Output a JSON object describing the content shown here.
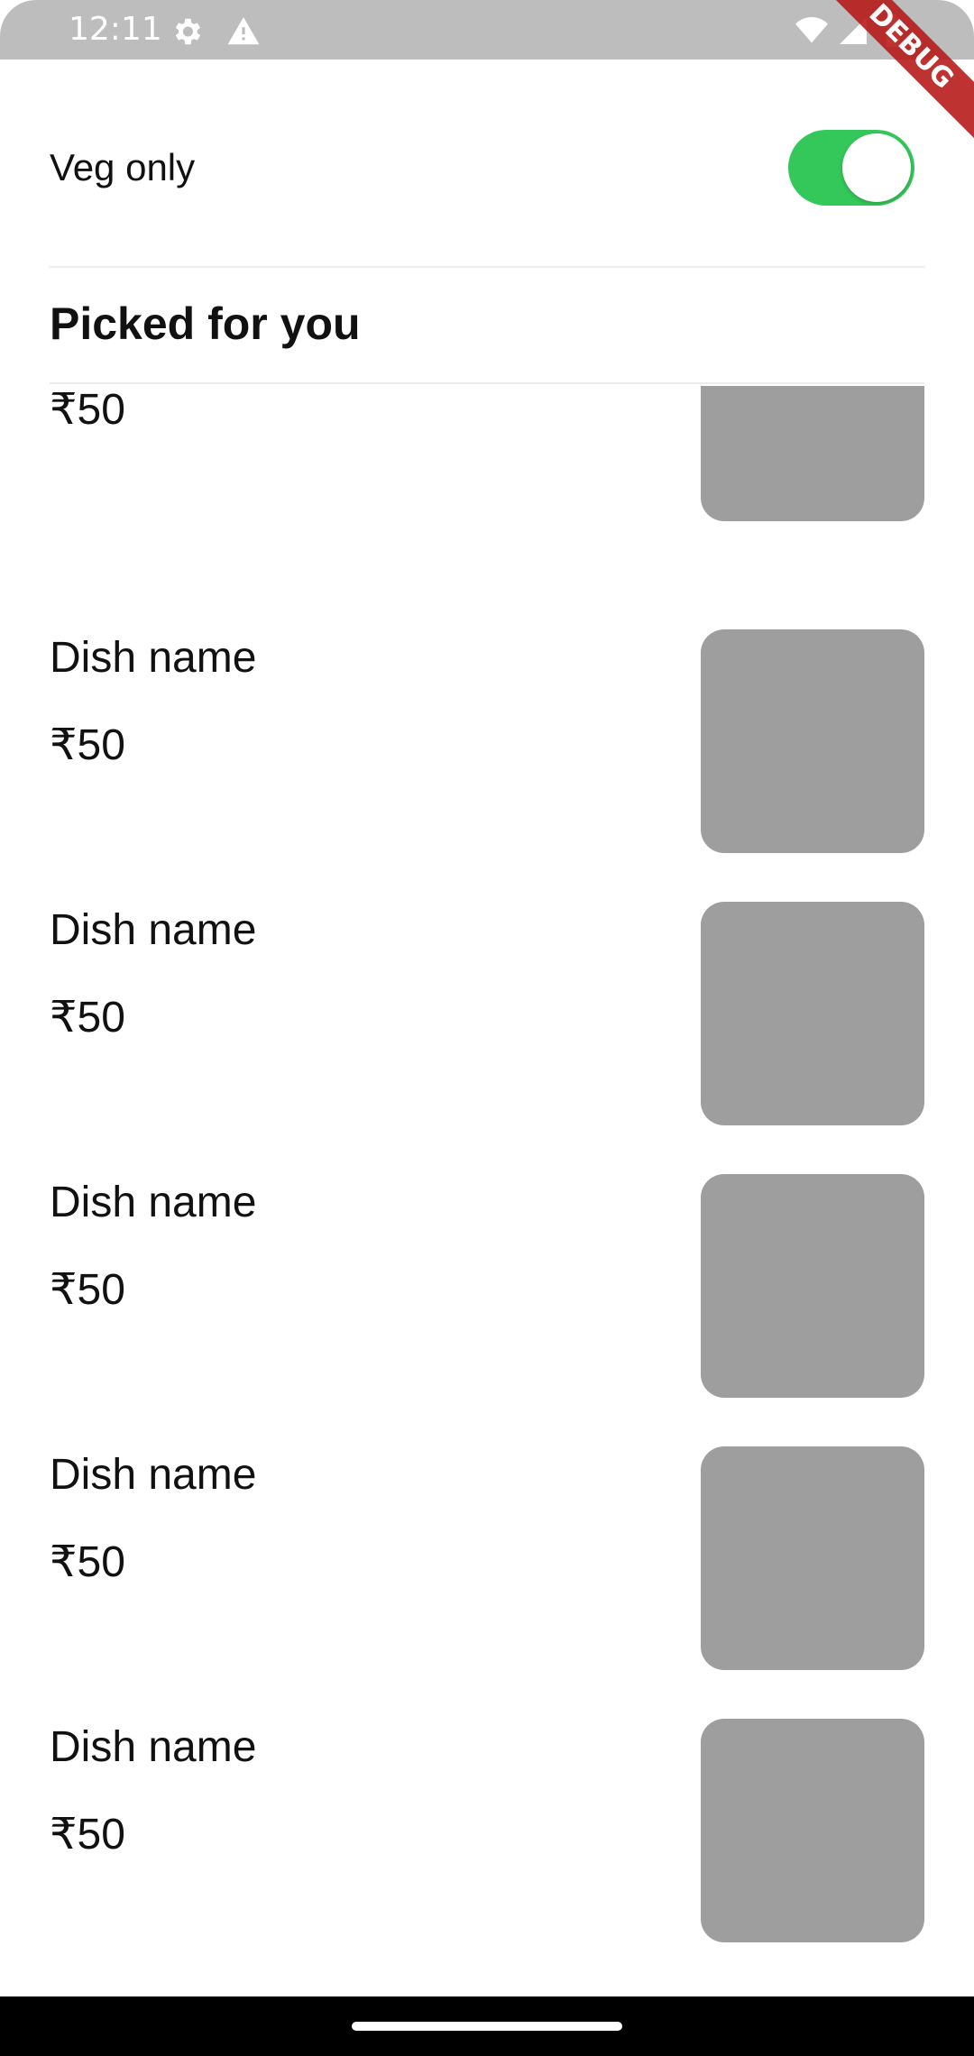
{
  "status_bar": {
    "time": "12:11"
  },
  "debug_banner": "DEBUG",
  "filter": {
    "label": "Veg only",
    "enabled": true
  },
  "section": {
    "title": "Picked for you"
  },
  "items": [
    {
      "name": "",
      "price": "₹50"
    },
    {
      "name": "Dish name",
      "price": "₹50"
    },
    {
      "name": "Dish name",
      "price": "₹50"
    },
    {
      "name": "Dish name",
      "price": "₹50"
    },
    {
      "name": "Dish name",
      "price": "₹50"
    },
    {
      "name": "Dish name",
      "price": "₹50"
    }
  ],
  "colors": {
    "toggle_on": "#34c759",
    "image_placeholder": "#9e9e9e",
    "status_bar": "#bdbdbd"
  }
}
